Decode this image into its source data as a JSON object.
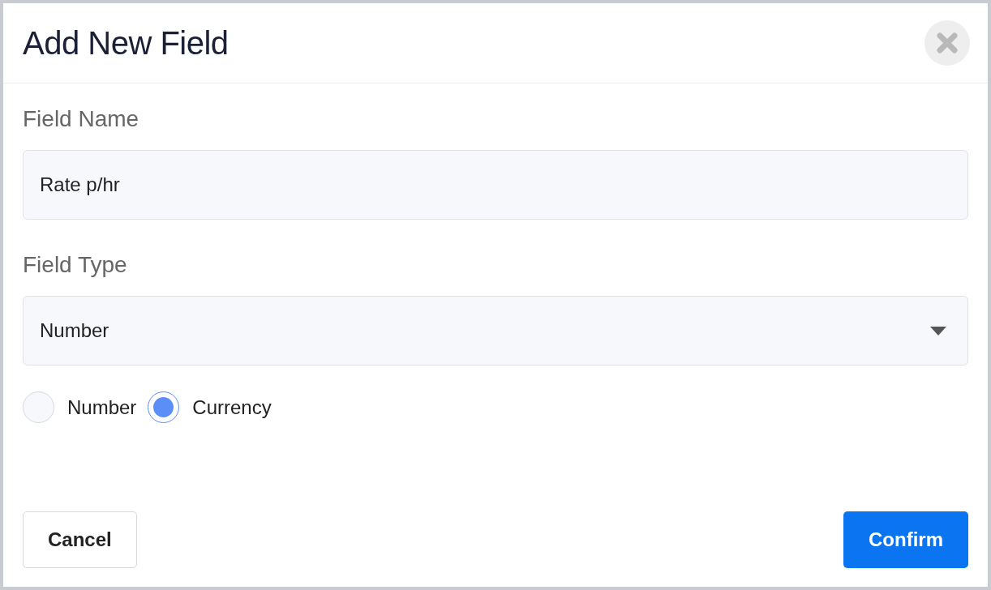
{
  "dialog": {
    "title": "Add New Field"
  },
  "fields": [
    {
      "label": "Field Name",
      "kind": "text",
      "value": "Rate p/hr"
    },
    {
      "label": "Field Type",
      "kind": "select",
      "value": "Number"
    }
  ],
  "format_options": [
    {
      "label": "Number",
      "selected": false
    },
    {
      "label": "Currency",
      "selected": true
    }
  ],
  "buttons": [
    {
      "label": "Cancel",
      "kind": "secondary"
    },
    {
      "label": "Confirm",
      "kind": "primary"
    }
  ]
}
